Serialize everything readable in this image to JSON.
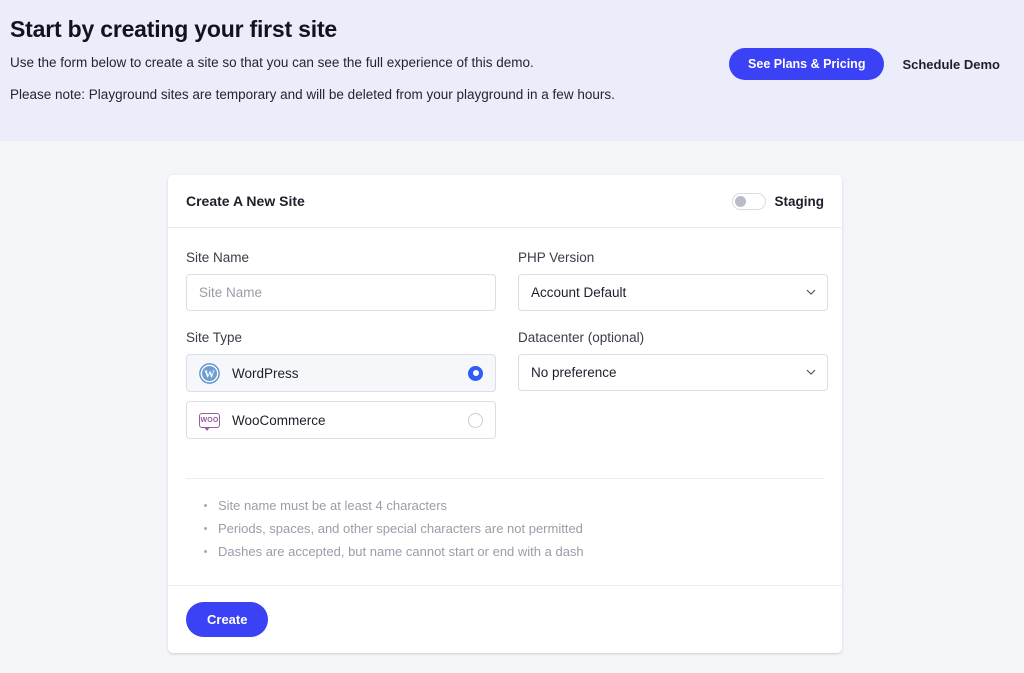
{
  "banner": {
    "title": "Start by creating your first site",
    "line1": "Use the form below to create a site so that you can see the full experience of this demo.",
    "line2": "Please note: Playground sites are temporary and will be deleted from your playground in a few hours.",
    "primary_button": "See Plans & Pricing",
    "secondary_link": "Schedule Demo",
    "accent_color": "#3b41f5",
    "background_color": "#ecedfb"
  },
  "card": {
    "title": "Create A New Site",
    "staging": {
      "label": "Staging",
      "enabled": false
    },
    "fields": {
      "site_name": {
        "label": "Site Name",
        "placeholder": "Site Name",
        "value": ""
      },
      "php_version": {
        "label": "PHP Version",
        "value": "Account Default"
      },
      "site_type": {
        "label": "Site Type",
        "options": [
          {
            "label": "WordPress",
            "icon": "wordpress-icon",
            "selected": true
          },
          {
            "label": "WooCommerce",
            "icon": "woocommerce-icon",
            "selected": false
          }
        ]
      },
      "datacenter": {
        "label": "Datacenter (optional)",
        "value": "No preference"
      }
    },
    "hints": [
      "Site name must be at least 4 characters",
      "Periods, spaces, and other special characters are not permitted",
      "Dashes are accepted, but name cannot start or end with a dash"
    ],
    "submit_button": "Create"
  }
}
